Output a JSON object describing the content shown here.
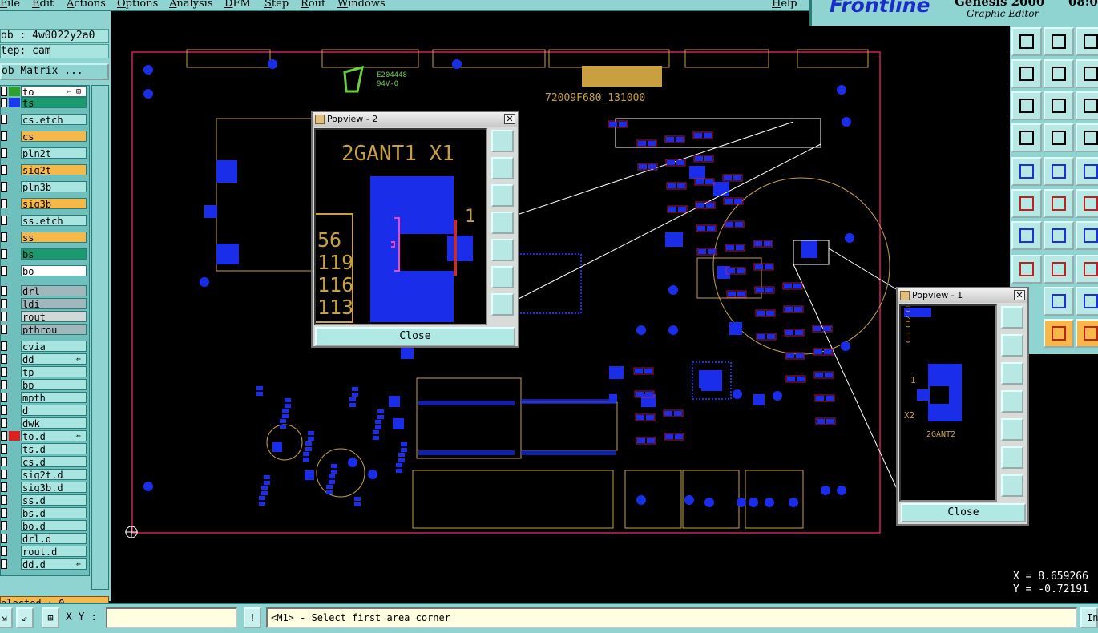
{
  "menu": [
    "File",
    "Edit",
    "Actions",
    "Options",
    "Analysis",
    "DFM",
    "Step",
    "Rout",
    "Windows",
    "Help"
  ],
  "logo": {
    "brand": "Frontline",
    "product": "Genesis 2000",
    "subtitle": "Graphic Editor",
    "clock": "08:0"
  },
  "left": {
    "job": "ob : 4w0022y2a0",
    "step": "tep: cam",
    "job_matrix": "ob Matrix ...",
    "selected": "elected : 0"
  },
  "layers": [
    {
      "name": "to",
      "swatch": "#2fa030",
      "bg": "#ffffff",
      "flag": "⇐ ⊞"
    },
    {
      "name": "ts",
      "swatch": "#1a3cf0",
      "bg": "#1a9a6e",
      "flag": ""
    },
    {
      "name": "cs.etch",
      "swatch": "",
      "bg": "#a8e4e0",
      "flag": ""
    },
    {
      "name": "cs",
      "swatch": "",
      "bg": "#f7b84a",
      "flag": ""
    },
    {
      "name": "pln2t",
      "swatch": "",
      "bg": "#a8e4e0",
      "flag": ""
    },
    {
      "name": "sig2t",
      "swatch": "",
      "bg": "#f7b84a",
      "flag": ""
    },
    {
      "name": "pln3b",
      "swatch": "",
      "bg": "#a8e4e0",
      "flag": ""
    },
    {
      "name": "sig3b",
      "swatch": "",
      "bg": "#f7b84a",
      "flag": ""
    },
    {
      "name": "ss.etch",
      "swatch": "",
      "bg": "#a8e4e0",
      "flag": ""
    },
    {
      "name": "ss",
      "swatch": "",
      "bg": "#f7b84a",
      "flag": ""
    },
    {
      "name": "bs",
      "swatch": "",
      "bg": "#1a9a6e",
      "flag": ""
    },
    {
      "name": "bo",
      "swatch": "",
      "bg": "#ffffff",
      "flag": ""
    },
    {
      "name": "drl",
      "swatch": "",
      "bg": "#a0b8bc",
      "flag": ""
    },
    {
      "name": "ldi",
      "swatch": "",
      "bg": "#a0b8bc",
      "flag": ""
    },
    {
      "name": "rout",
      "swatch": "",
      "bg": "#d0d8d8",
      "flag": ""
    },
    {
      "name": "pthrou",
      "swatch": "",
      "bg": "#a0b8bc",
      "flag": ""
    },
    {
      "name": "cvia",
      "swatch": "",
      "bg": "#a8e4e0",
      "flag": ""
    },
    {
      "name": "dd",
      "swatch": "",
      "bg": "#a8e4e0",
      "flag": "⇐"
    },
    {
      "name": "tp",
      "swatch": "",
      "bg": "#a8e4e0",
      "flag": ""
    },
    {
      "name": "bp",
      "swatch": "",
      "bg": "#a8e4e0",
      "flag": ""
    },
    {
      "name": "mpth",
      "swatch": "",
      "bg": "#a8e4e0",
      "flag": ""
    },
    {
      "name": "d",
      "swatch": "",
      "bg": "#a8e4e0",
      "flag": ""
    },
    {
      "name": "dwk",
      "swatch": "",
      "bg": "#a8e4e0",
      "flag": ""
    },
    {
      "name": "to.d",
      "swatch": "#e02020",
      "bg": "#a8e4e0",
      "flag": "⇐"
    },
    {
      "name": "ts.d",
      "swatch": "",
      "bg": "#a8e4e0",
      "flag": ""
    },
    {
      "name": "cs.d",
      "swatch": "",
      "bg": "#a8e4e0",
      "flag": ""
    },
    {
      "name": "sig2t.d",
      "swatch": "",
      "bg": "#a8e4e0",
      "flag": ""
    },
    {
      "name": "sig3b.d",
      "swatch": "",
      "bg": "#a8e4e0",
      "flag": ""
    },
    {
      "name": "ss.d",
      "swatch": "",
      "bg": "#a8e4e0",
      "flag": ""
    },
    {
      "name": "bs.d",
      "swatch": "",
      "bg": "#a8e4e0",
      "flag": ""
    },
    {
      "name": "bo.d",
      "swatch": "",
      "bg": "#a8e4e0",
      "flag": ""
    },
    {
      "name": "drl.d",
      "swatch": "",
      "bg": "#a8e4e0",
      "flag": ""
    },
    {
      "name": "rout.d",
      "swatch": "",
      "bg": "#a8e4e0",
      "flag": ""
    },
    {
      "name": "dd.d",
      "swatch": "",
      "bg": "#a8e4e0",
      "flag": "⇐"
    }
  ],
  "bottom": {
    "xy_label": "X Y :",
    "xy_value": "",
    "message": "<M1> - Select first area corner",
    "right_button": "In"
  },
  "coords": {
    "x": "X = 8.659266",
    "y": "Y = -0.72191"
  },
  "board_text": {
    "part_number": "72009F680_131000",
    "ul_mark": "E204448",
    "ul_sub": "94V-0"
  },
  "popview2": {
    "title": "Popview - 2",
    "label": "2GANT1  X1",
    "pin_label": "1",
    "numbers": [
      "56",
      "119",
      "116",
      "113"
    ],
    "close": "Close"
  },
  "popview1": {
    "title": "Popview - 1",
    "pin_label": "1",
    "ref_x2": "X2",
    "ref_label": "2GANT2",
    "side_text": "C11 C12 C13 R57",
    "close": "Close"
  },
  "colors": {
    "panel": "#8fd4d0",
    "trace": "#c8a040",
    "pad": "#1a2de8",
    "mask": "#d02060"
  }
}
